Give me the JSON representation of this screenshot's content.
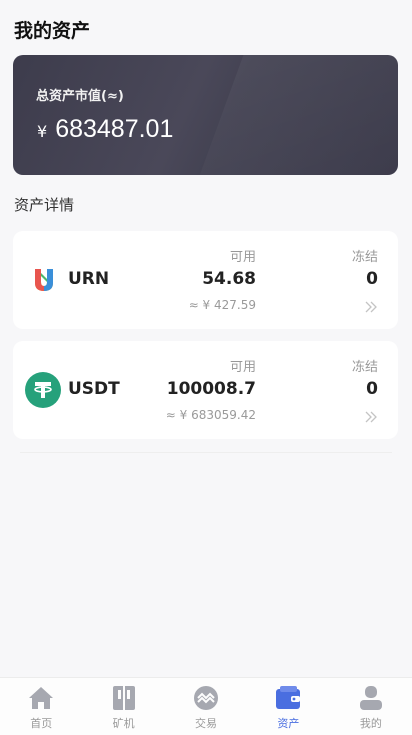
{
  "page": {
    "title": "我的资产"
  },
  "summary": {
    "label": "总资产市值(≈)",
    "currency": "¥",
    "amount": "683487.01"
  },
  "section": {
    "title": "资产详情"
  },
  "assets": [
    {
      "name": "URN",
      "available_label": "可用",
      "available": "54.68",
      "approx": "≈ ¥ 427.59",
      "frozen_label": "冻结",
      "frozen": "0"
    },
    {
      "name": "USDT",
      "available_label": "可用",
      "available": "100008.7",
      "approx": "≈ ¥ 683059.42",
      "frozen_label": "冻结",
      "frozen": "0"
    }
  ],
  "tabbar": {
    "items": [
      {
        "label": "首页",
        "icon": "home-icon"
      },
      {
        "label": "矿机",
        "icon": "miner-icon"
      },
      {
        "label": "交易",
        "icon": "trade-icon"
      },
      {
        "label": "资产",
        "icon": "wallet-icon",
        "active": true
      },
      {
        "label": "我的",
        "icon": "user-icon"
      }
    ]
  },
  "colors": {
    "accent": "#4a6ee0",
    "card_dark": "#403f4f",
    "usdt_green": "#26a17b"
  }
}
